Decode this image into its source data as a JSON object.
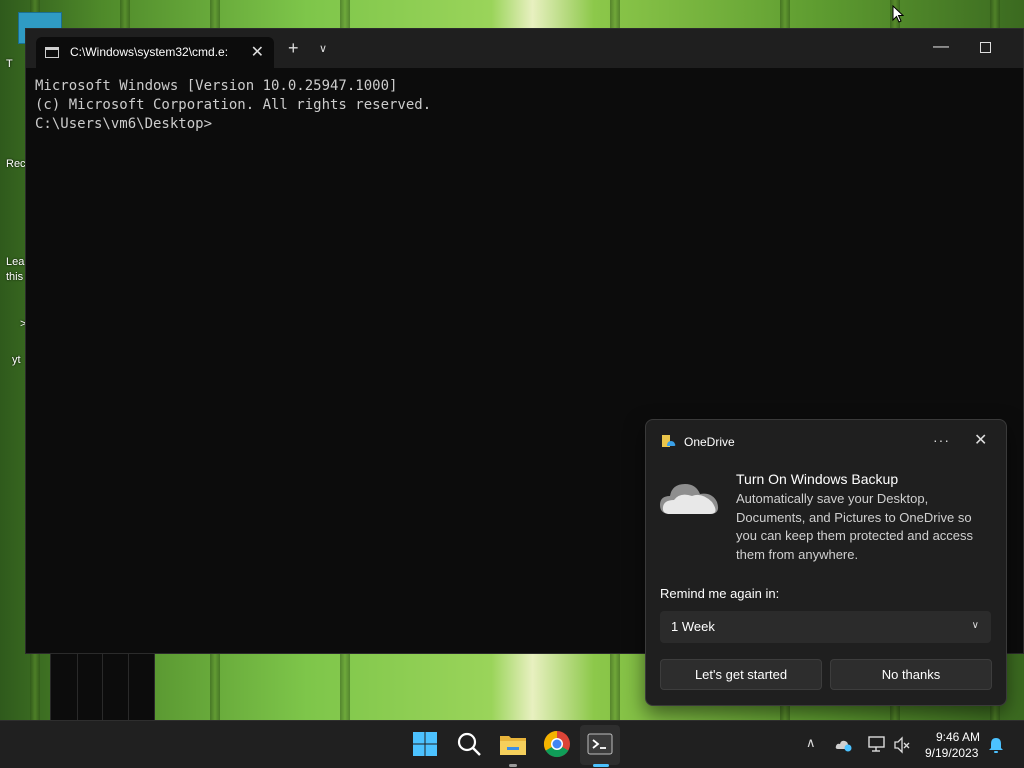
{
  "desktop": {
    "partial_labels": [
      "T",
      "Rec",
      "Lea",
      "this",
      ">",
      "yt"
    ]
  },
  "terminal": {
    "tab_title": "C:\\Windows\\system32\\cmd.e:",
    "lines": [
      "Microsoft Windows [Version 10.0.25947.1000]",
      "(c) Microsoft Corporation. All rights reserved.",
      "",
      "C:\\Users\\vm6\\Desktop>"
    ]
  },
  "toast": {
    "app_name": "OneDrive",
    "title": "Turn On Windows Backup",
    "body": "Automatically save your Desktop, Documents, and Pictures to OneDrive so you can keep them protected and access them from anywhere.",
    "remind_label": "Remind me again in:",
    "remind_value": "1 Week",
    "primary_button": "Let's get started",
    "secondary_button": "No thanks"
  },
  "taskbar": {
    "icons": [
      "windows-start-icon",
      "search-icon",
      "file-explorer-icon",
      "chrome-icon",
      "terminal-icon"
    ],
    "time": "9:46 AM",
    "date": "9/19/2023"
  },
  "colors": {
    "terminal_bg": "#0c0c0c",
    "toast_bg": "#1f1f1f",
    "taskbar_bg": "#202020",
    "accent": "#4cc2ff"
  }
}
